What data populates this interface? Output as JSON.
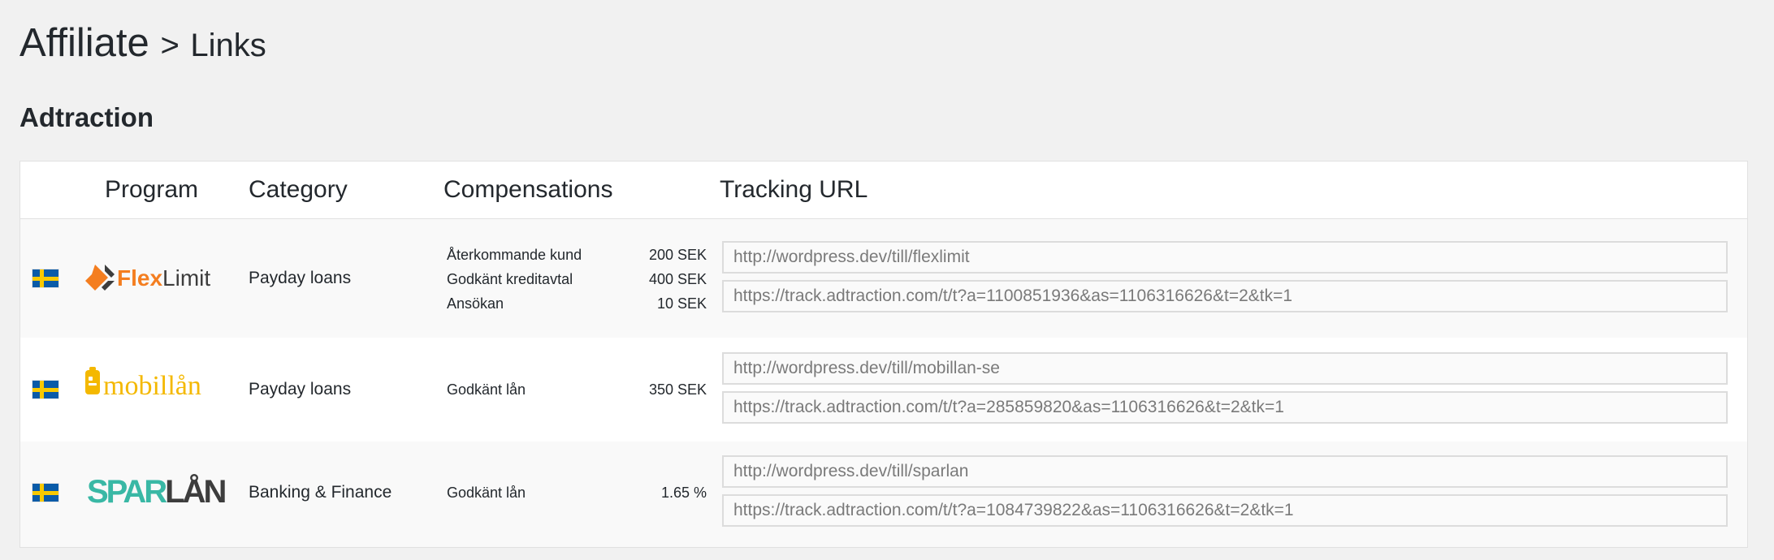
{
  "header": {
    "title": "Affiliate",
    "separator": ">",
    "subtitle": "Links"
  },
  "section": {
    "title": "Adtraction"
  },
  "table": {
    "columns": [
      "Program",
      "Category",
      "Compensations",
      "Tracking URL"
    ],
    "rows": [
      {
        "country": "Sweden",
        "program": {
          "name": "FlexLimit",
          "logo_parts": [
            "Flex",
            "Limit"
          ]
        },
        "category": "Payday loans",
        "compensations": [
          {
            "label": "Återkommande kund",
            "value": "200 SEK"
          },
          {
            "label": "Godkänt kreditavtal",
            "value": "400 SEK"
          },
          {
            "label": "Ansökan",
            "value": "10 SEK"
          }
        ],
        "urls": [
          "http://wordpress.dev/till/flexlimit",
          "https://track.adtraction.com/t/t?a=1100851936&as=1106316626&t=2&tk=1"
        ]
      },
      {
        "country": "Sweden",
        "program": {
          "name": "mobillån",
          "logo_parts": [
            "mobillån"
          ]
        },
        "category": "Payday loans",
        "compensations": [
          {
            "label": "Godkänt lån",
            "value": "350 SEK"
          }
        ],
        "urls": [
          "http://wordpress.dev/till/mobillan-se",
          "https://track.adtraction.com/t/t?a=285859820&as=1106316626&t=2&tk=1"
        ]
      },
      {
        "country": "Sweden",
        "program": {
          "name": "SPARLÅN",
          "logo_parts": [
            "SPAR",
            "LÅN"
          ]
        },
        "category": "Banking & Finance",
        "compensations": [
          {
            "label": "Godkänt lån",
            "value": "1.65 %"
          }
        ],
        "urls": [
          "http://wordpress.dev/till/sparlan",
          "https://track.adtraction.com/t/t?a=1084739822&as=1106316626&t=2&tk=1"
        ]
      }
    ]
  },
  "colors": {
    "background": "#f1f1f1",
    "text": "#23282d",
    "flexlimit_orange": "#f47e20",
    "mobillan_yellow": "#f4b800",
    "sparlan_teal": "#39b8a5",
    "sparlan_dark": "#3d3d3d",
    "flag_blue": "#0a5ba8",
    "flag_yellow": "#f8c900"
  }
}
